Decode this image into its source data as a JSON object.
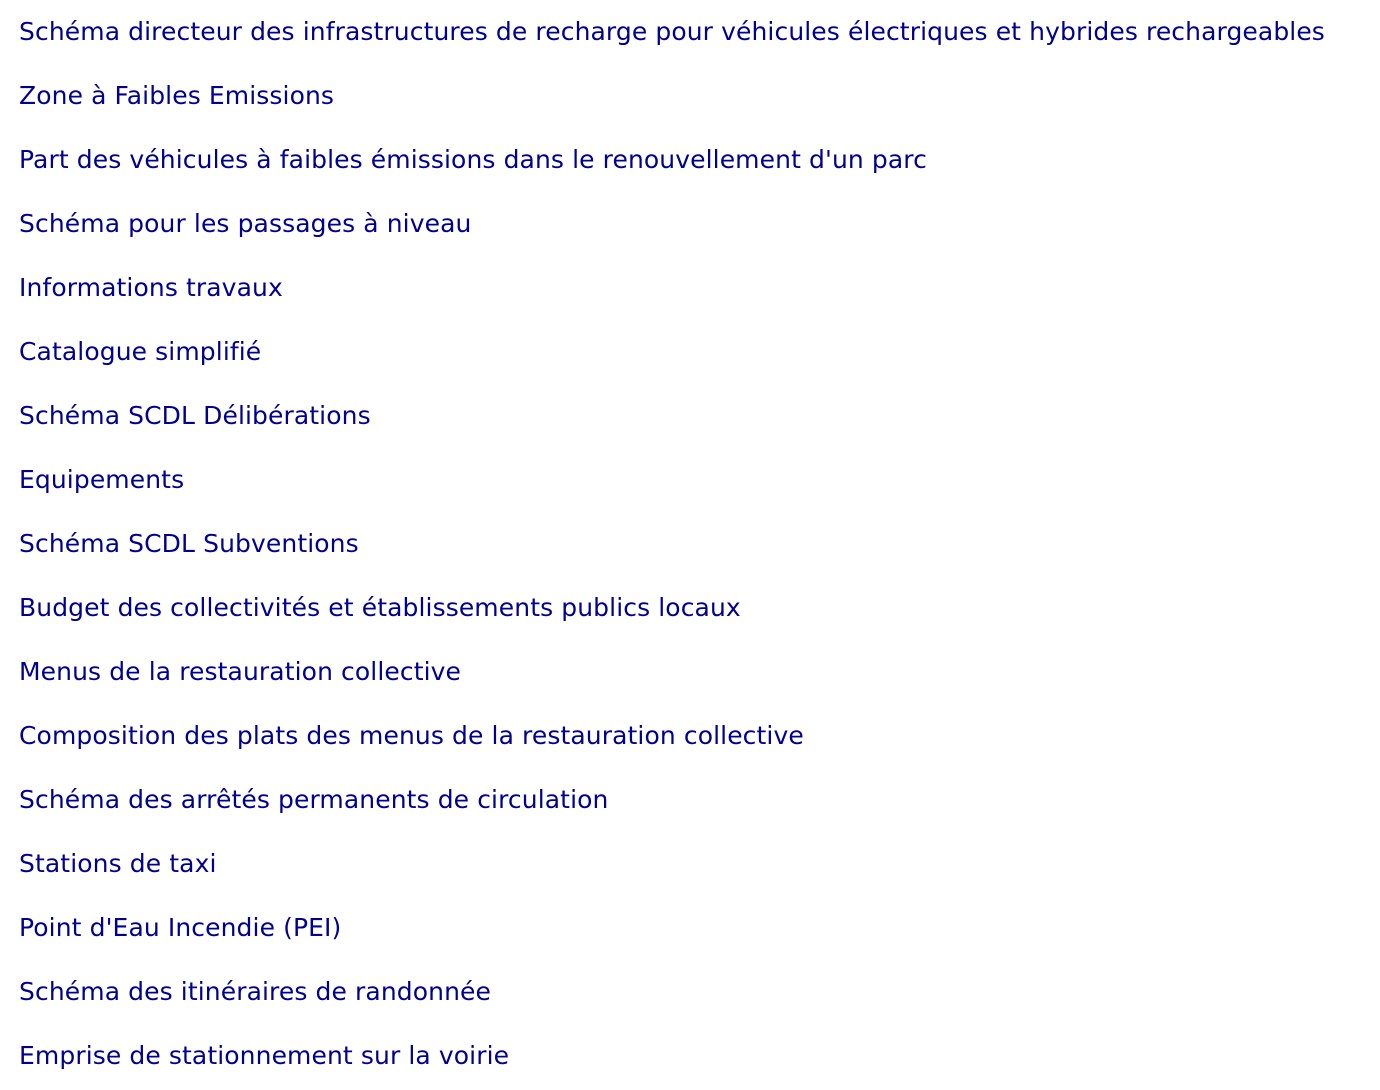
{
  "links": [
    "Schéma directeur des infrastructures de recharge pour véhicules électriques et hybrides rechargeables",
    "Zone à Faibles Emissions",
    "Part des véhicules à faibles émissions dans le renouvellement d'un parc",
    "Schéma pour les passages à niveau",
    "Informations travaux",
    "Catalogue simplifié",
    "Schéma SCDL Délibérations",
    "Equipements",
    "Schéma SCDL Subventions",
    "Budget des collectivités et établissements publics locaux",
    "Menus de la restauration collective",
    "Composition des plats des menus de la restauration collective",
    "Schéma des arrêtés permanents de circulation",
    "Stations de taxi",
    "Point d'Eau Incendie (PEI)",
    "Schéma des itinéraires de randonnée",
    "Emprise de stationnement sur la voirie"
  ],
  "colors": {
    "link": "#000091",
    "background": "#ffffff"
  }
}
